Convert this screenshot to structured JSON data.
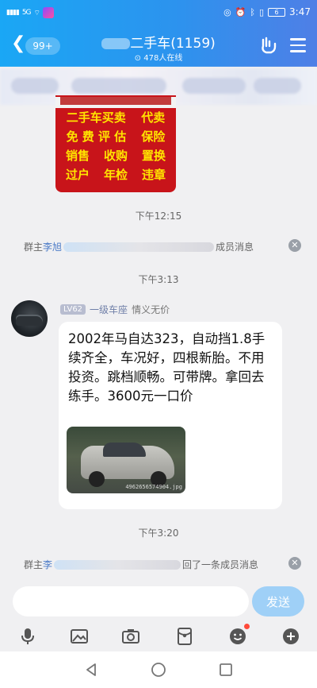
{
  "status_bar": {
    "left_signal_text": "5G",
    "right_battery": "6",
    "clock": "3:47"
  },
  "header": {
    "unread_badge": "99+",
    "title": "二手车(1159)",
    "online_count": "478人在线"
  },
  "poster": {
    "rows": [
      [
        "二手车买卖",
        "代卖"
      ],
      [
        "免 费 评 估",
        "保险"
      ],
      [
        "销售",
        "收购",
        "置换"
      ],
      [
        "过户",
        "年检",
        "违章"
      ]
    ]
  },
  "messages": {
    "time1": "下午12:15",
    "sys1_prefix": "群主",
    "sys1_name": "李旭",
    "sys1_suffix": "成员消息",
    "time2": "下午3:13",
    "sender_level": "LV62",
    "sender_rank": "一级车座",
    "sender_name": "情义无价",
    "body": "2002年马自达323，自动挡1.8手续齐全，车况好，四根新胎。不用投资。跳档顺畅。可带牌。拿回去练手。3600元一口价",
    "photo_stamp": "4962656574904.jpg",
    "time3": "下午3:20",
    "sys2_prefix": "群主",
    "sys2_name": "李",
    "sys2_suffix": "回了一条成员消息"
  },
  "composer": {
    "placeholder": "",
    "send_label": "发送"
  },
  "icons": {
    "voice": "microphone-icon",
    "image": "image-icon",
    "camera": "camera-icon",
    "red_packet": "red-packet-icon",
    "emoji": "emoji-icon",
    "plus": "plus-icon"
  },
  "colors": {
    "accent": "#2c93ee",
    "send_button": "#9fd0f7",
    "poster_red": "#c8141a",
    "poster_yellow": "#ffe400"
  }
}
